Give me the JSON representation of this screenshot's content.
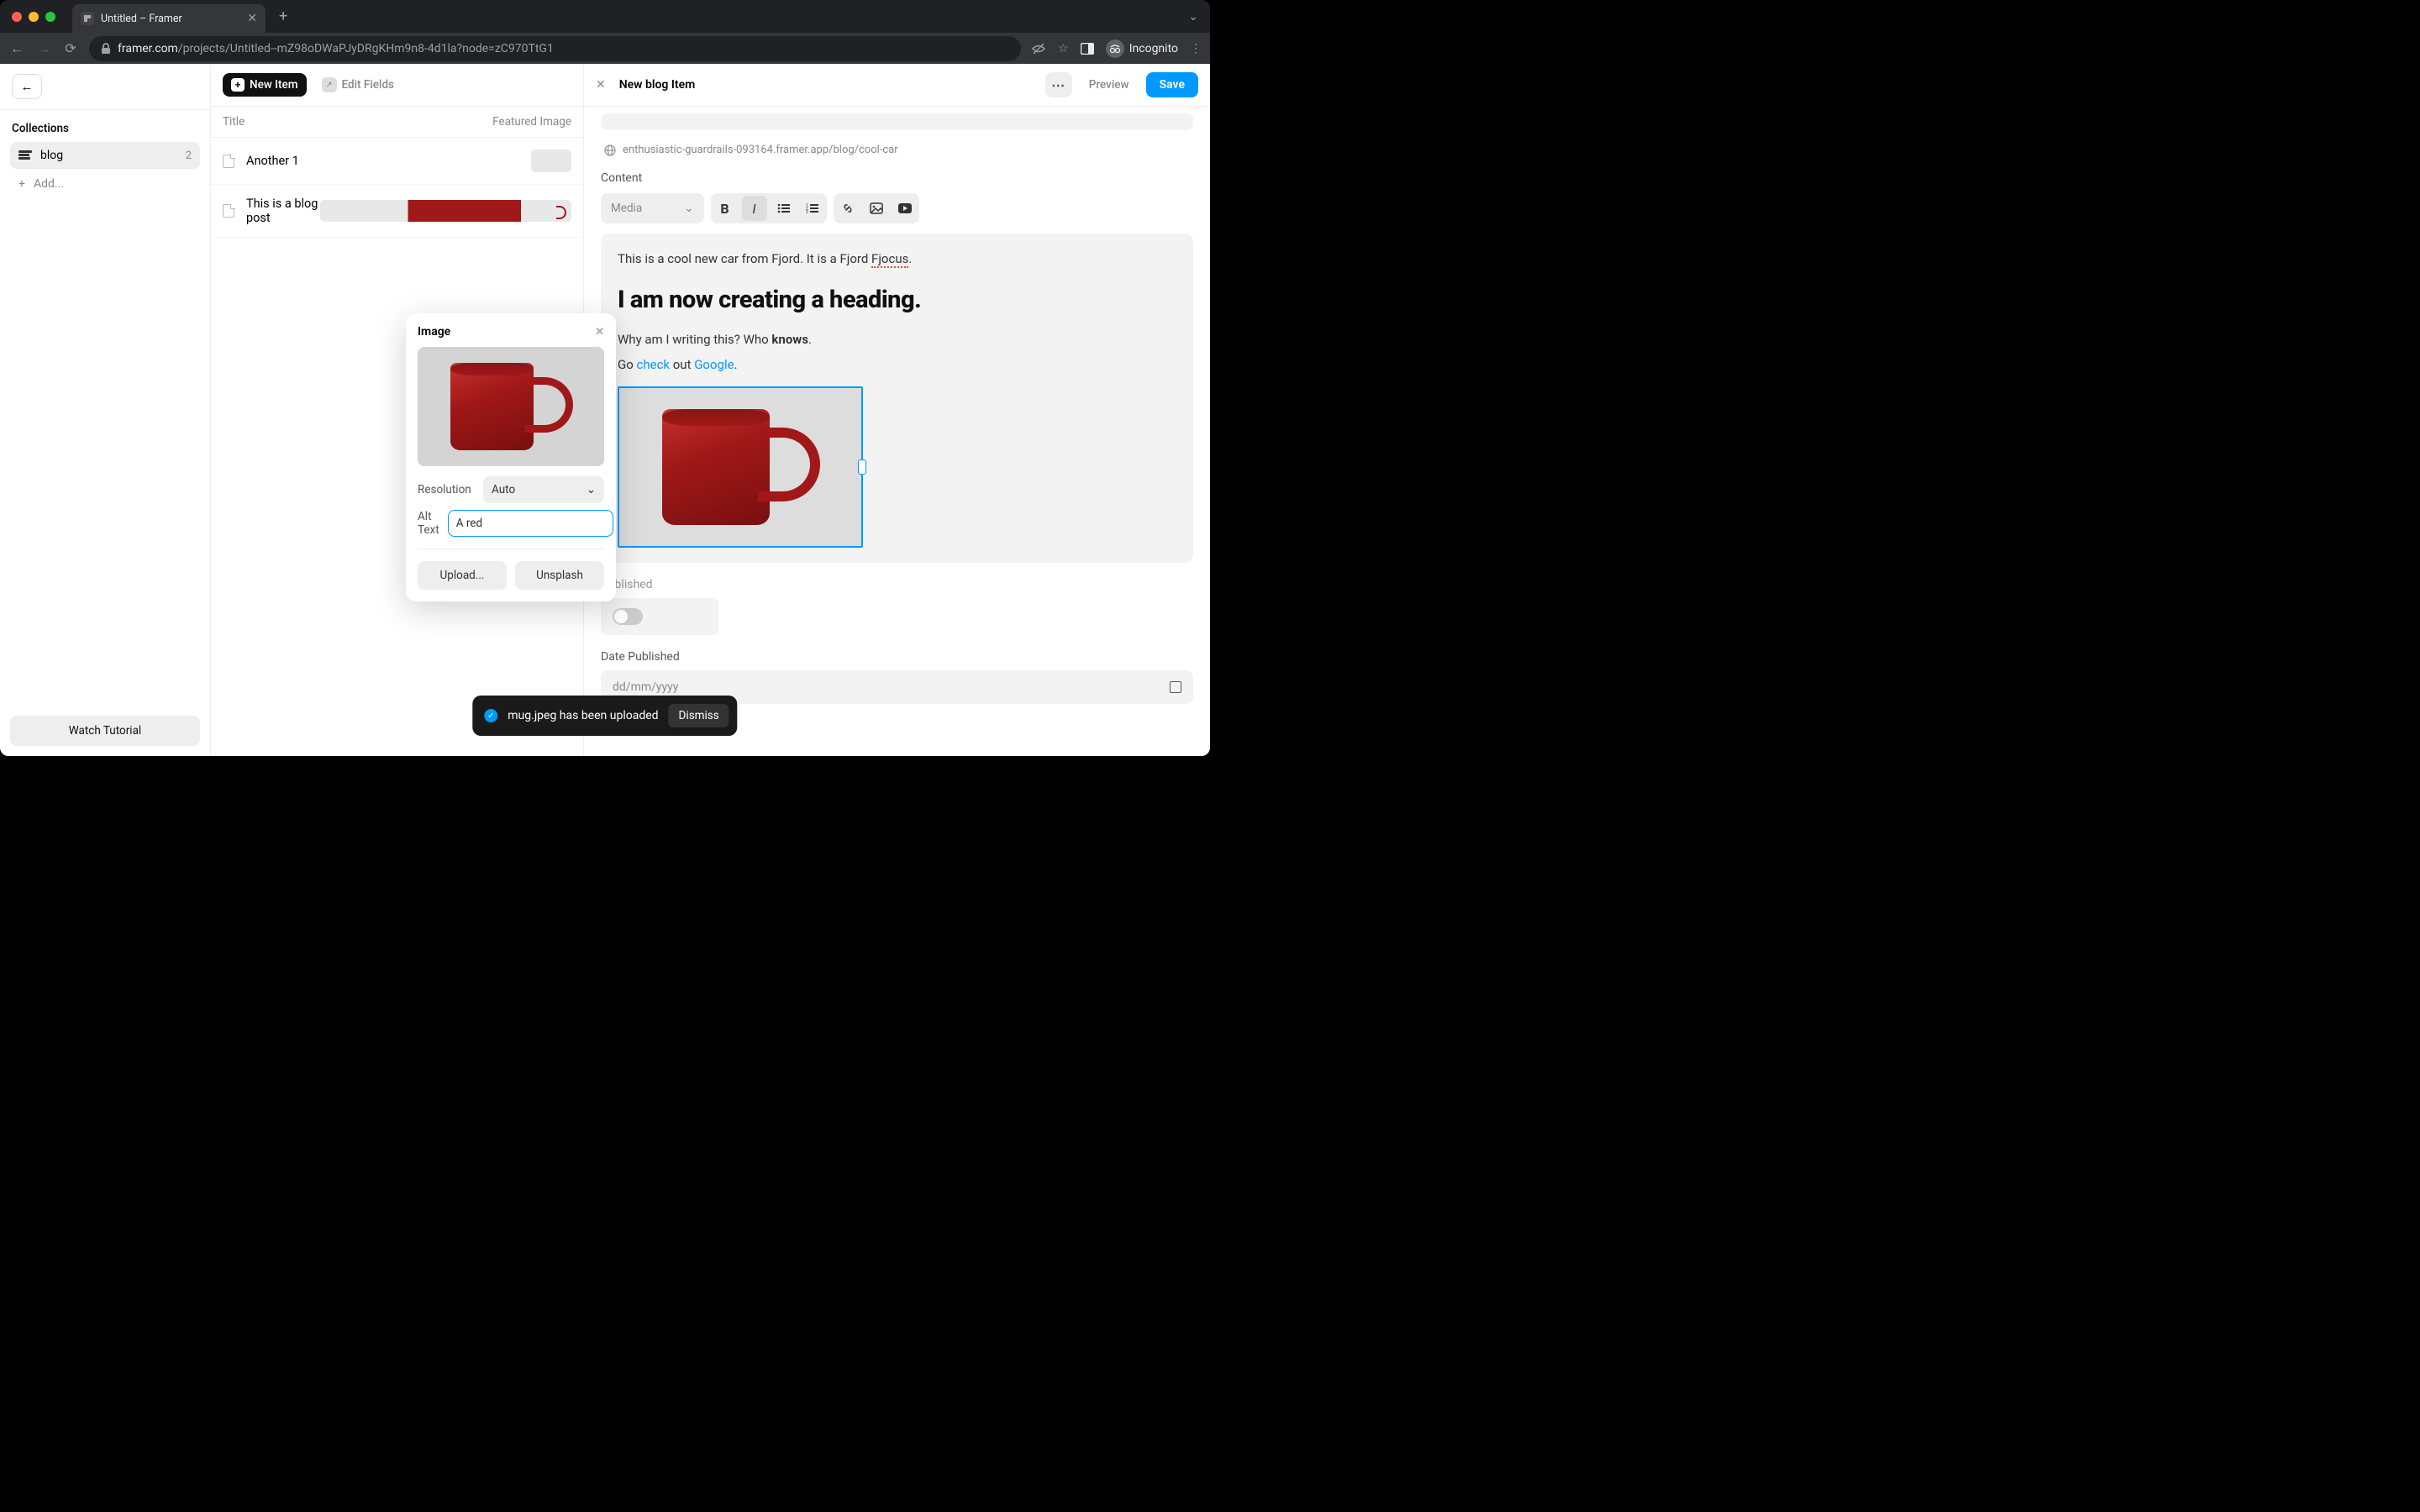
{
  "browser": {
    "tab_title": "Untitled – Framer",
    "url_host": "framer.com",
    "url_path": "/projects/Untitled--mZ98oDWaPJyDRgKHm9n8-4d1la?node=zC970TtG1",
    "incognito_label": "Incognito"
  },
  "sidebar": {
    "header": "Collections",
    "items": [
      {
        "label": "blog",
        "count": "2"
      }
    ],
    "add_label": "Add...",
    "tutorial_label": "Watch Tutorial"
  },
  "middle": {
    "new_item_label": "New Item",
    "edit_fields_label": "Edit Fields",
    "columns": {
      "title": "Title",
      "featured": "Featured Image"
    },
    "rows": [
      {
        "title": "Another 1",
        "thumb": "empty"
      },
      {
        "title": "This is a blog post",
        "thumb": "mug"
      }
    ]
  },
  "panel": {
    "title": "New blog Item",
    "preview_label": "Preview",
    "save_label": "Save",
    "slug_url": "enthusiastic-guardrails-093164.framer.app/blog/cool-car",
    "content_label": "Content",
    "media_label": "Media",
    "body": {
      "p1_a": "This is a cool new car from Fjord. It is a Fjord ",
      "p1_spell": "Fjocus",
      "p1_b": ".",
      "h2": "I am now creating a heading.",
      "p2_a": "Why am I writing this? Who ",
      "p2_bold": "knows",
      "p2_b": ".",
      "p3_a": "Go ",
      "p3_link1": "check",
      "p3_b": " out ",
      "p3_link2": "Google",
      "p3_c": "."
    },
    "published_label": "Published",
    "date_label": "Date Published",
    "date_placeholder": "dd/mm/yyyy"
  },
  "popover": {
    "title": "Image",
    "resolution_label": "Resolution",
    "resolution_value": "Auto",
    "alt_label": "Alt Text",
    "alt_value": "A red ",
    "upload_label": "Upload...",
    "unsplash_label": "Unsplash"
  },
  "toast": {
    "message": "mug.jpeg has been uploaded",
    "dismiss_label": "Dismiss"
  }
}
